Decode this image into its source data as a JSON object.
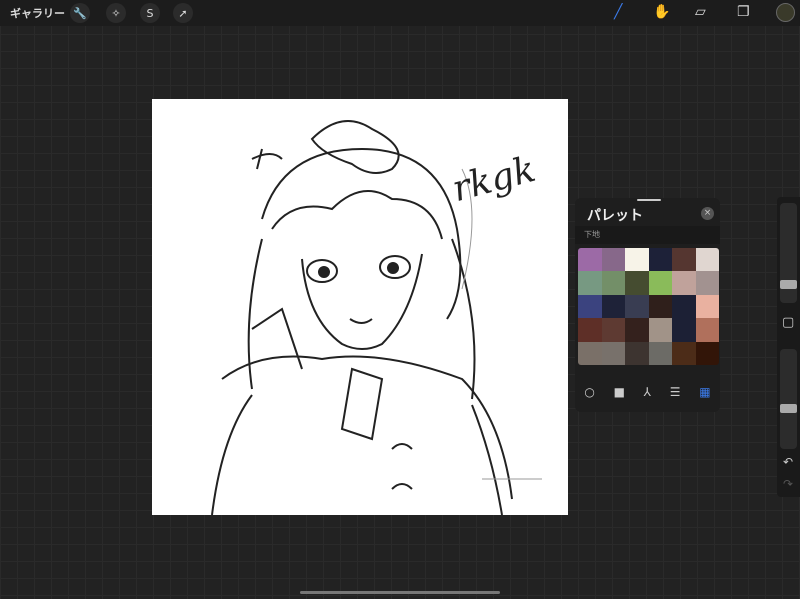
{
  "topbar": {
    "gallery": "ギャラリー",
    "tools": [
      {
        "icon": "wrench-icon",
        "glyph": "🔧"
      },
      {
        "icon": "magic-wand-icon",
        "glyph": "✧"
      },
      {
        "icon": "selection-icon",
        "glyph": "S"
      },
      {
        "icon": "transform-arrow-icon",
        "glyph": "➚"
      }
    ],
    "right": [
      {
        "icon": "brush-icon",
        "glyph": "╱",
        "color": "#3b7bea"
      },
      {
        "icon": "smudge-icon",
        "glyph": "✋",
        "color": "#ddd"
      },
      {
        "icon": "eraser-icon",
        "glyph": "▱",
        "color": "#ddd"
      },
      {
        "icon": "layers-icon",
        "glyph": "❐",
        "color": "#ddd"
      }
    ]
  },
  "palette": {
    "title": "パレット",
    "close": "×",
    "name": "下地",
    "colors": [
      "#9c6aa6",
      "#87688a",
      "#f7f3e8",
      "#1d2138",
      "#553630",
      "#e0d6d0",
      "#779982",
      "#738f68",
      "#454c30",
      "#8abb5a",
      "#c0a29b",
      "#a29290",
      "#3b437f",
      "#1e2238",
      "#393d52",
      "#2f1f1b",
      "#1c2035",
      "#e9b1a0",
      "#5e2f27",
      "#5e3a32",
      "#34211d",
      "#a19388",
      "#1c2035",
      "#b0705c",
      "#7a7068",
      "#78716b",
      "#3d3430",
      "#6c6b66",
      "#4c2c18",
      "#321508"
    ],
    "tabs": [
      {
        "icon": "disc-icon",
        "glyph": "○"
      },
      {
        "icon": "classic-icon",
        "glyph": "■"
      },
      {
        "icon": "harmony-icon",
        "glyph": "⅄"
      },
      {
        "icon": "value-icon",
        "glyph": "☰"
      },
      {
        "icon": "palettes-icon",
        "glyph": "▦",
        "active": true
      }
    ]
  },
  "sidebar": {
    "modify": "▢",
    "undo": "↶",
    "redo": "↷",
    "size": 0.15,
    "opacity": 0.4
  },
  "canvas": {
    "handwriting": "rkgk"
  }
}
